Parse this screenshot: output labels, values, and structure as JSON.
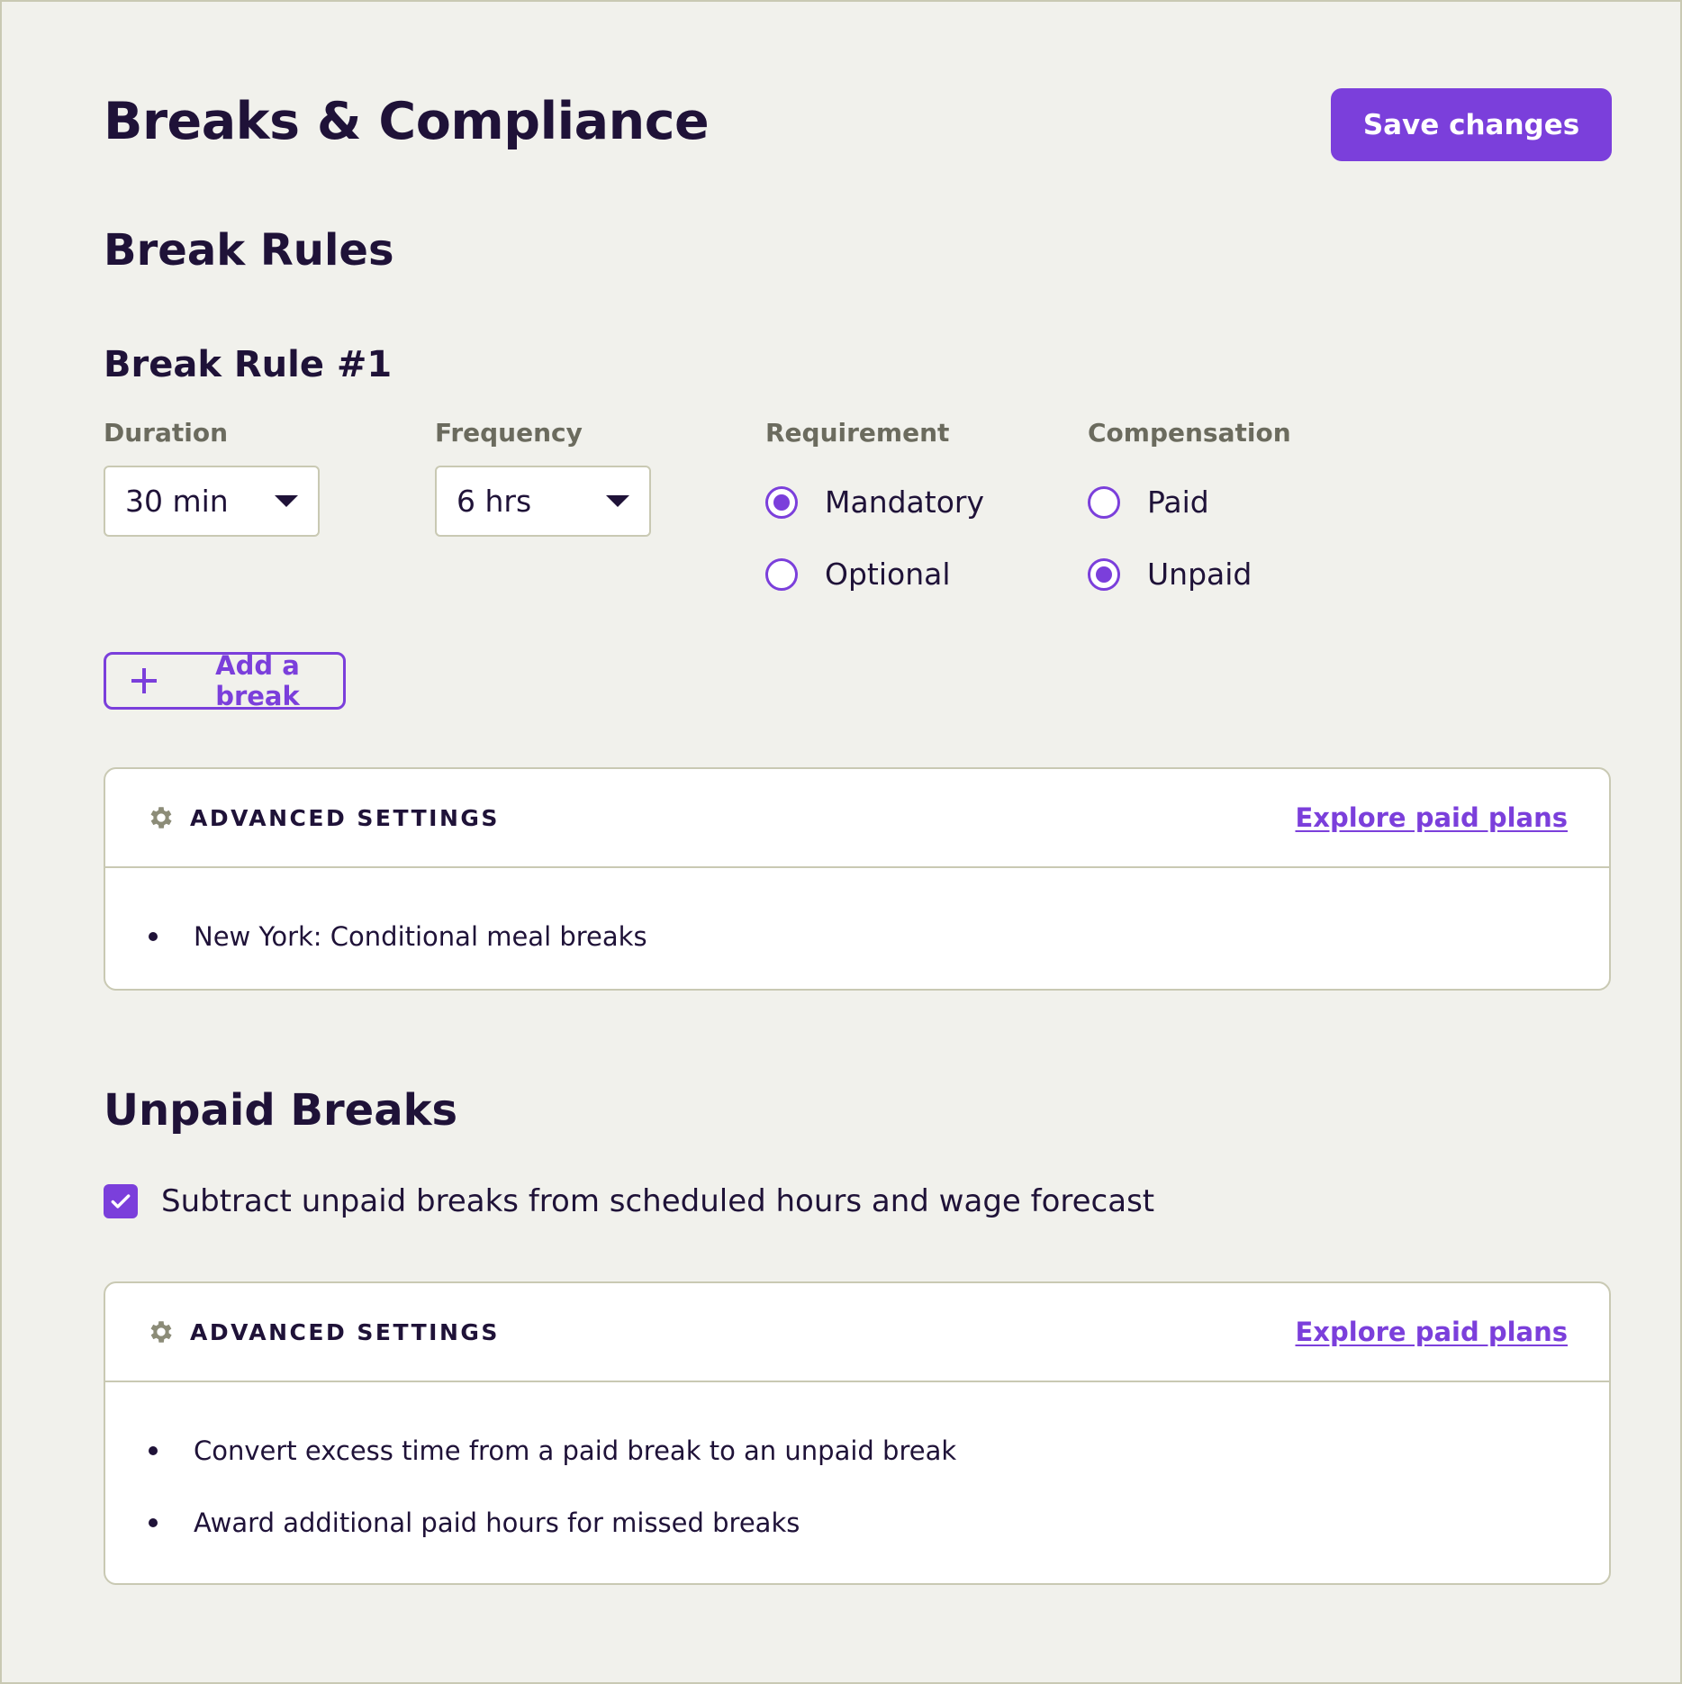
{
  "header": {
    "title": "Breaks & Compliance",
    "save_label": "Save changes"
  },
  "break_rules": {
    "title": "Break Rules",
    "rule_title": "Break Rule #1",
    "duration": {
      "label": "Duration",
      "value": "30 min"
    },
    "frequency": {
      "label": "Frequency",
      "value": "6 hrs"
    },
    "requirement": {
      "label": "Requirement",
      "options": [
        {
          "label": "Mandatory",
          "selected": true
        },
        {
          "label": "Optional",
          "selected": false
        }
      ]
    },
    "compensation": {
      "label": "Compensation",
      "options": [
        {
          "label": "Paid",
          "selected": false
        },
        {
          "label": "Unpaid",
          "selected": true
        }
      ]
    },
    "add_break_label": "Add a break",
    "advanced": {
      "title": "ADVANCED SETTINGS",
      "link": "Explore paid plans",
      "items": [
        "New York: Conditional meal breaks"
      ]
    }
  },
  "unpaid_breaks": {
    "title": "Unpaid Breaks",
    "subtract_checkbox": {
      "label": "Subtract unpaid breaks from scheduled hours and wage forecast",
      "checked": true
    },
    "advanced": {
      "title": "ADVANCED SETTINGS",
      "link": "Explore paid plans",
      "items": [
        "Convert excess time from a paid break to an unpaid break",
        "Award additional paid hours for missed breaks"
      ]
    }
  },
  "icons": {
    "gear": "gear-icon",
    "plus": "plus-icon",
    "caret": "caret-down-icon",
    "check": "check-icon"
  },
  "colors": {
    "accent": "#7b3fdb",
    "background": "#f1f1ec",
    "text": "#1f1238",
    "muted": "#6b6b5e",
    "border": "#c9c9b3"
  }
}
